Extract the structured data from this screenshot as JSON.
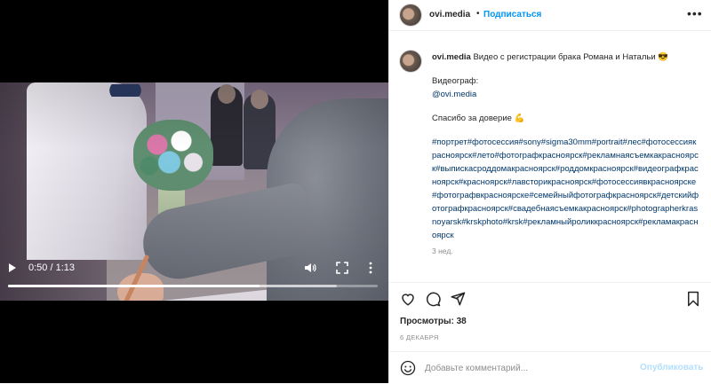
{
  "video": {
    "time_display": "0:50 / 1:13",
    "progress_fraction": 0.68,
    "buffered_fraction": 0.89,
    "icons": [
      "play-icon",
      "volume-icon",
      "fullscreen-icon",
      "more-vertical-icon"
    ]
  },
  "header": {
    "username": "ovi.media",
    "separator": "•",
    "follow_label": "Подписаться",
    "options_glyph": "•••"
  },
  "caption": {
    "username": "ovi.media",
    "text": "Видео с регистрации брака Романа и Натальи",
    "emoji": "😎",
    "videographer_label": "Видеограф:",
    "mention": "@ovi.media",
    "thanks": "Спасибо за доверие",
    "thanks_emoji": "💪",
    "hashtags": "#портрет#фотосессия#sony#sigma30mm#portrait#лес#фотосессиякрасноярск#лето#фотографкрасноярск#рекламнаясъемкакрасноярск#выпискасроддомакрасноярск#роддомкрасноярск#видеографкрасноярск#красноярск#лавсторикрасноярск#фотосессиявкрасноярске#фотографвкрасноярске#семейныйфотографкрасноярск#детскийфотографкрасноярск#свадебнаясъемкакрасноярск#photographerkrasnoyarsk#krskphoto#krsk#рекламныйроликкрасноярск#рекламакрасноярск",
    "time_ago": "3 нед."
  },
  "actions": {
    "icons": [
      "heart-icon",
      "comment-icon",
      "share-icon",
      "bookmark-icon"
    ]
  },
  "stats": {
    "views_label": "Просмотры:",
    "views_count": "38",
    "date": "6 ДЕКАБРЯ"
  },
  "comment_box": {
    "placeholder": "Добавьте комментарий...",
    "publish_label": "Опубликовать"
  },
  "colors": {
    "link_blue": "#0095f6",
    "hashtag_blue": "#00376b",
    "publish_disabled": "#b2dffc"
  }
}
